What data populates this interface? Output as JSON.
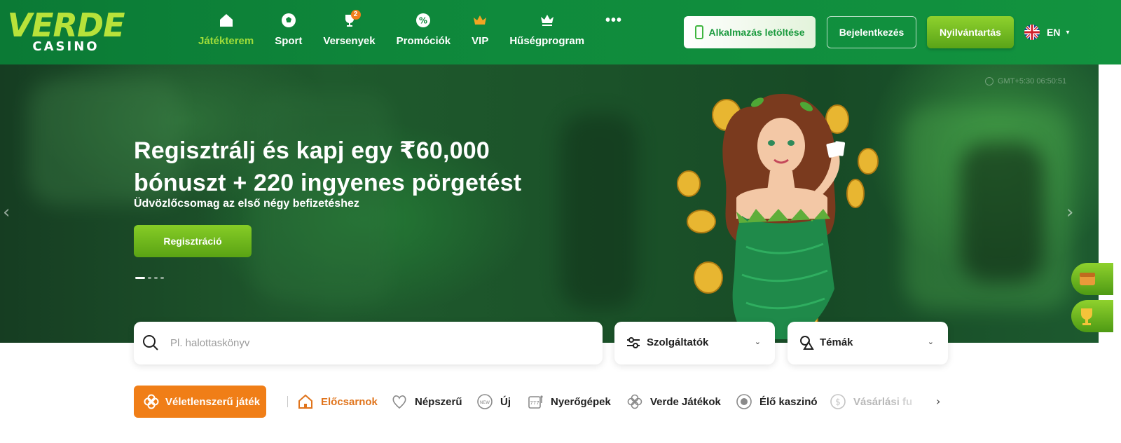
{
  "brand": {
    "logo_top": "VERDE",
    "logo_bottom": "CASINO"
  },
  "nav": {
    "items": [
      {
        "label": "Játékterem",
        "icon": "home-icon",
        "active": true
      },
      {
        "label": "Sport",
        "icon": "soccer-ball-icon"
      },
      {
        "label": "Versenyek",
        "icon": "trophy-icon",
        "badge": "2"
      },
      {
        "label": "Promóciók",
        "icon": "percent-badge-icon"
      },
      {
        "label": "VIP",
        "icon": "crown-icon"
      },
      {
        "label": "Hűségprogram",
        "icon": "loyalty-crown-icon"
      }
    ],
    "more": "•••"
  },
  "header": {
    "app_button": "Alkalmazás letöltése",
    "login_button": "Bejelentkezés",
    "register_button": "Nyilvántartás",
    "language": "EN"
  },
  "hero": {
    "timer": "GMT+5:30  06:50:51",
    "title": "Regisztrálj és kapj egy ₹60,000 bónuszt + 220 ingyenes pörgetést",
    "subtitle": "Üdvözlőcsomag az első négy befizetéshez",
    "cta": "Regisztráció",
    "slides_total": 4,
    "slide_active": 1
  },
  "search": {
    "placeholder": "Pl. halottaskönyv"
  },
  "filters": {
    "providers": "Szolgáltatók",
    "themes": "Témák"
  },
  "categories": {
    "random": "Véletlenszerű játék",
    "items": [
      {
        "label": "Előcsarnok",
        "icon": "home-outline-icon",
        "active": true
      },
      {
        "label": "Népszerű",
        "icon": "heart-icon"
      },
      {
        "label": "Új",
        "icon": "new-badge-icon"
      },
      {
        "label": "Nyerőgépek",
        "icon": "slot-machine-icon"
      },
      {
        "label": "Verde Játékok",
        "icon": "clover-icon"
      },
      {
        "label": "Élő kaszinó",
        "icon": "live-dot-icon"
      },
      {
        "label": "Vásárlási fu",
        "icon": "dollar-coin-icon"
      }
    ]
  },
  "colors": {
    "header_green": "#0f8a3c",
    "accent_lime": "#8fd12d",
    "active_nav": "#9fdc3a",
    "orange": "#f07e17"
  }
}
